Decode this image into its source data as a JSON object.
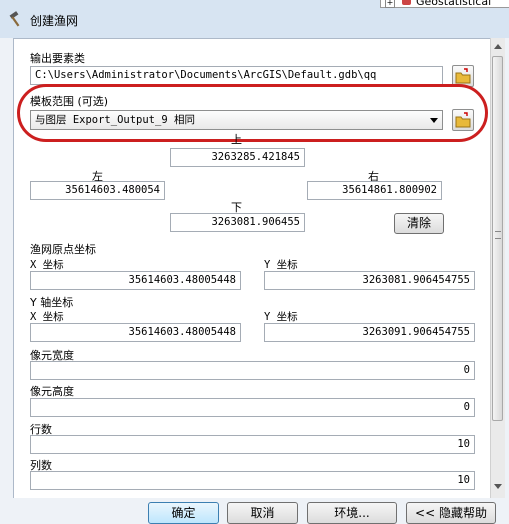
{
  "window": {
    "title": "创建渔网",
    "background_window_title": "Geostatistical"
  },
  "output": {
    "label": "输出要素类",
    "value": "C:\\Users\\Administrator\\Documents\\ArcGIS\\Default.gdb\\qq"
  },
  "template": {
    "label": "模板范围 (可选)",
    "value": "与图层 Export_Output_9 相同"
  },
  "extent": {
    "top_label": "上",
    "top_value": "3263285.421845",
    "left_label": "左",
    "left_value": "35614603.480054",
    "right_label": "右",
    "right_value": "35614861.800902",
    "bottom_label": "下",
    "bottom_value": "3263081.906455",
    "clear_label": "清除"
  },
  "origin": {
    "label": "渔网原点坐标",
    "x_label": "X 坐标",
    "x_value": "35614603.48005448",
    "y_label": "Y 坐标",
    "y_value": "3263081.906454755"
  },
  "yaxis": {
    "label": "Y 轴坐标",
    "x_label": "X 坐标",
    "x_value": "35614603.48005448",
    "y_label": "Y 坐标",
    "y_value": "3263091.906454755"
  },
  "cell_width": {
    "label": "像元宽度",
    "value": "0"
  },
  "cell_height": {
    "label": "像元高度",
    "value": "0"
  },
  "rows": {
    "label": "行数",
    "value": "10"
  },
  "cols": {
    "label": "列数",
    "value": "10"
  },
  "buttons": {
    "ok": "确定",
    "cancel": "取消",
    "env": "环境...",
    "help": "<< 隐藏帮助"
  },
  "colors": {
    "highlight_oval": "#cc1f1f",
    "titlebar": "#d7e4f2"
  }
}
